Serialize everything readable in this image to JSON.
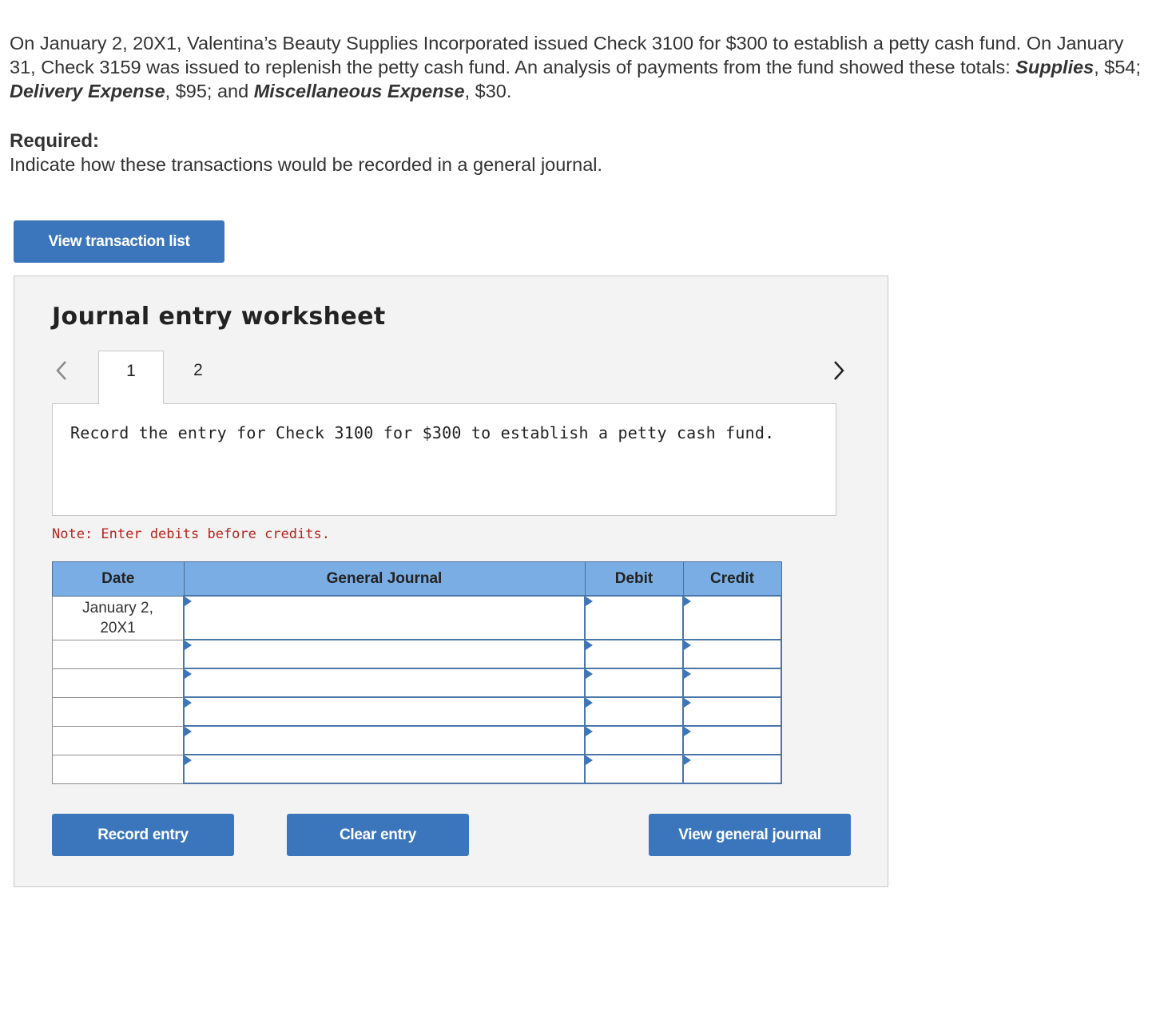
{
  "intro": {
    "p1": "On January 2, 20X1, Valentina’s Beauty Supplies Incorporated issued Check 3100 for $300 to establish a petty cash fund. On January 31, Check 3159 was issued to replenish the petty cash fund. An analysis of payments from the fund showed these totals: ",
    "acct1": "Supplies",
    "amt1": ", $54; ",
    "acct2": "Delivery Expense",
    "amt2": ", $95; and ",
    "acct3": "Miscellaneous Expense",
    "amt3": ", $30."
  },
  "required": {
    "title": "Required:",
    "text": "Indicate how these transactions would be recorded in a general journal."
  },
  "buttons": {
    "view_transaction_list": "View transaction list",
    "record_entry": "Record entry",
    "clear_entry": "Clear entry",
    "view_general_journal": "View general journal"
  },
  "worksheet": {
    "title": "Journal entry worksheet",
    "tabs": [
      "1",
      "2"
    ],
    "active_tab": "1",
    "prompt": "Record the entry for Check 3100 for $300 to establish a petty cash fund.",
    "note": "Note: Enter debits before credits."
  },
  "journal": {
    "headers": {
      "date": "Date",
      "general_journal": "General Journal",
      "debit": "Debit",
      "credit": "Credit"
    },
    "first_date_line1": "January 2,",
    "first_date_line2": "20X1"
  },
  "colors": {
    "button_blue": "#3b76bd",
    "header_blue": "#7aade3",
    "note_red": "#b8241c",
    "panel_gray": "#f3f3f3"
  },
  "icons": {
    "prev": "chevron-left-icon",
    "next": "chevron-right-icon"
  }
}
